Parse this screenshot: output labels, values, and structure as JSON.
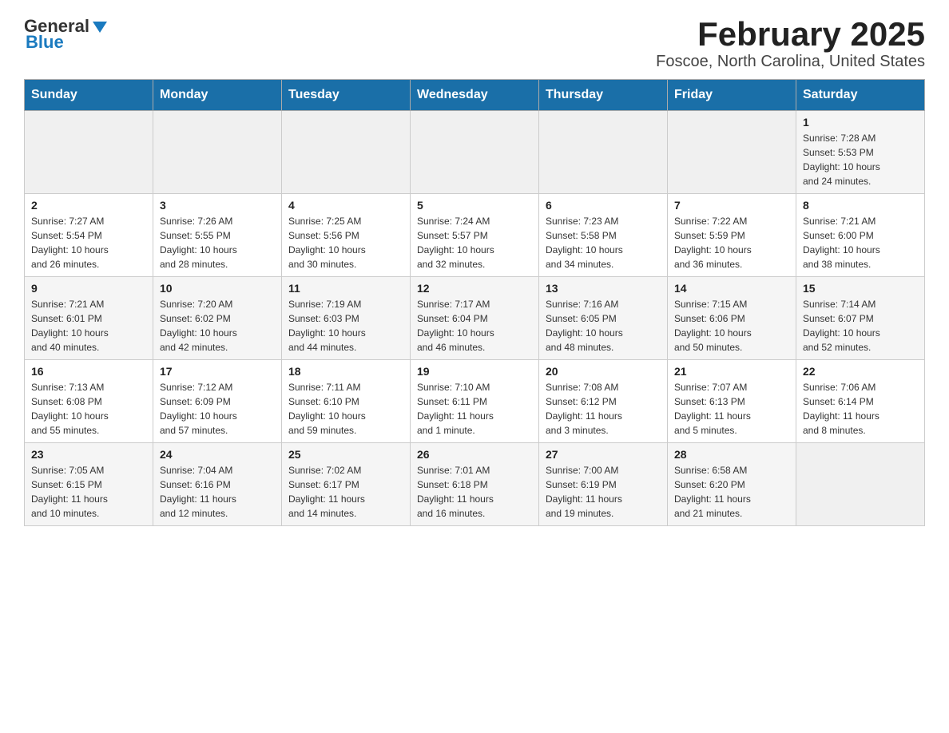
{
  "header": {
    "logo_general": "General",
    "logo_blue": "Blue",
    "title": "February 2025",
    "subtitle": "Foscoe, North Carolina, United States"
  },
  "days_of_week": [
    "Sunday",
    "Monday",
    "Tuesday",
    "Wednesday",
    "Thursday",
    "Friday",
    "Saturday"
  ],
  "weeks": [
    {
      "days": [
        {
          "number": "",
          "info": ""
        },
        {
          "number": "",
          "info": ""
        },
        {
          "number": "",
          "info": ""
        },
        {
          "number": "",
          "info": ""
        },
        {
          "number": "",
          "info": ""
        },
        {
          "number": "",
          "info": ""
        },
        {
          "number": "1",
          "info": "Sunrise: 7:28 AM\nSunset: 5:53 PM\nDaylight: 10 hours\nand 24 minutes."
        }
      ]
    },
    {
      "days": [
        {
          "number": "2",
          "info": "Sunrise: 7:27 AM\nSunset: 5:54 PM\nDaylight: 10 hours\nand 26 minutes."
        },
        {
          "number": "3",
          "info": "Sunrise: 7:26 AM\nSunset: 5:55 PM\nDaylight: 10 hours\nand 28 minutes."
        },
        {
          "number": "4",
          "info": "Sunrise: 7:25 AM\nSunset: 5:56 PM\nDaylight: 10 hours\nand 30 minutes."
        },
        {
          "number": "5",
          "info": "Sunrise: 7:24 AM\nSunset: 5:57 PM\nDaylight: 10 hours\nand 32 minutes."
        },
        {
          "number": "6",
          "info": "Sunrise: 7:23 AM\nSunset: 5:58 PM\nDaylight: 10 hours\nand 34 minutes."
        },
        {
          "number": "7",
          "info": "Sunrise: 7:22 AM\nSunset: 5:59 PM\nDaylight: 10 hours\nand 36 minutes."
        },
        {
          "number": "8",
          "info": "Sunrise: 7:21 AM\nSunset: 6:00 PM\nDaylight: 10 hours\nand 38 minutes."
        }
      ]
    },
    {
      "days": [
        {
          "number": "9",
          "info": "Sunrise: 7:21 AM\nSunset: 6:01 PM\nDaylight: 10 hours\nand 40 minutes."
        },
        {
          "number": "10",
          "info": "Sunrise: 7:20 AM\nSunset: 6:02 PM\nDaylight: 10 hours\nand 42 minutes."
        },
        {
          "number": "11",
          "info": "Sunrise: 7:19 AM\nSunset: 6:03 PM\nDaylight: 10 hours\nand 44 minutes."
        },
        {
          "number": "12",
          "info": "Sunrise: 7:17 AM\nSunset: 6:04 PM\nDaylight: 10 hours\nand 46 minutes."
        },
        {
          "number": "13",
          "info": "Sunrise: 7:16 AM\nSunset: 6:05 PM\nDaylight: 10 hours\nand 48 minutes."
        },
        {
          "number": "14",
          "info": "Sunrise: 7:15 AM\nSunset: 6:06 PM\nDaylight: 10 hours\nand 50 minutes."
        },
        {
          "number": "15",
          "info": "Sunrise: 7:14 AM\nSunset: 6:07 PM\nDaylight: 10 hours\nand 52 minutes."
        }
      ]
    },
    {
      "days": [
        {
          "number": "16",
          "info": "Sunrise: 7:13 AM\nSunset: 6:08 PM\nDaylight: 10 hours\nand 55 minutes."
        },
        {
          "number": "17",
          "info": "Sunrise: 7:12 AM\nSunset: 6:09 PM\nDaylight: 10 hours\nand 57 minutes."
        },
        {
          "number": "18",
          "info": "Sunrise: 7:11 AM\nSunset: 6:10 PM\nDaylight: 10 hours\nand 59 minutes."
        },
        {
          "number": "19",
          "info": "Sunrise: 7:10 AM\nSunset: 6:11 PM\nDaylight: 11 hours\nand 1 minute."
        },
        {
          "number": "20",
          "info": "Sunrise: 7:08 AM\nSunset: 6:12 PM\nDaylight: 11 hours\nand 3 minutes."
        },
        {
          "number": "21",
          "info": "Sunrise: 7:07 AM\nSunset: 6:13 PM\nDaylight: 11 hours\nand 5 minutes."
        },
        {
          "number": "22",
          "info": "Sunrise: 7:06 AM\nSunset: 6:14 PM\nDaylight: 11 hours\nand 8 minutes."
        }
      ]
    },
    {
      "days": [
        {
          "number": "23",
          "info": "Sunrise: 7:05 AM\nSunset: 6:15 PM\nDaylight: 11 hours\nand 10 minutes."
        },
        {
          "number": "24",
          "info": "Sunrise: 7:04 AM\nSunset: 6:16 PM\nDaylight: 11 hours\nand 12 minutes."
        },
        {
          "number": "25",
          "info": "Sunrise: 7:02 AM\nSunset: 6:17 PM\nDaylight: 11 hours\nand 14 minutes."
        },
        {
          "number": "26",
          "info": "Sunrise: 7:01 AM\nSunset: 6:18 PM\nDaylight: 11 hours\nand 16 minutes."
        },
        {
          "number": "27",
          "info": "Sunrise: 7:00 AM\nSunset: 6:19 PM\nDaylight: 11 hours\nand 19 minutes."
        },
        {
          "number": "28",
          "info": "Sunrise: 6:58 AM\nSunset: 6:20 PM\nDaylight: 11 hours\nand 21 minutes."
        },
        {
          "number": "",
          "info": ""
        }
      ]
    }
  ]
}
